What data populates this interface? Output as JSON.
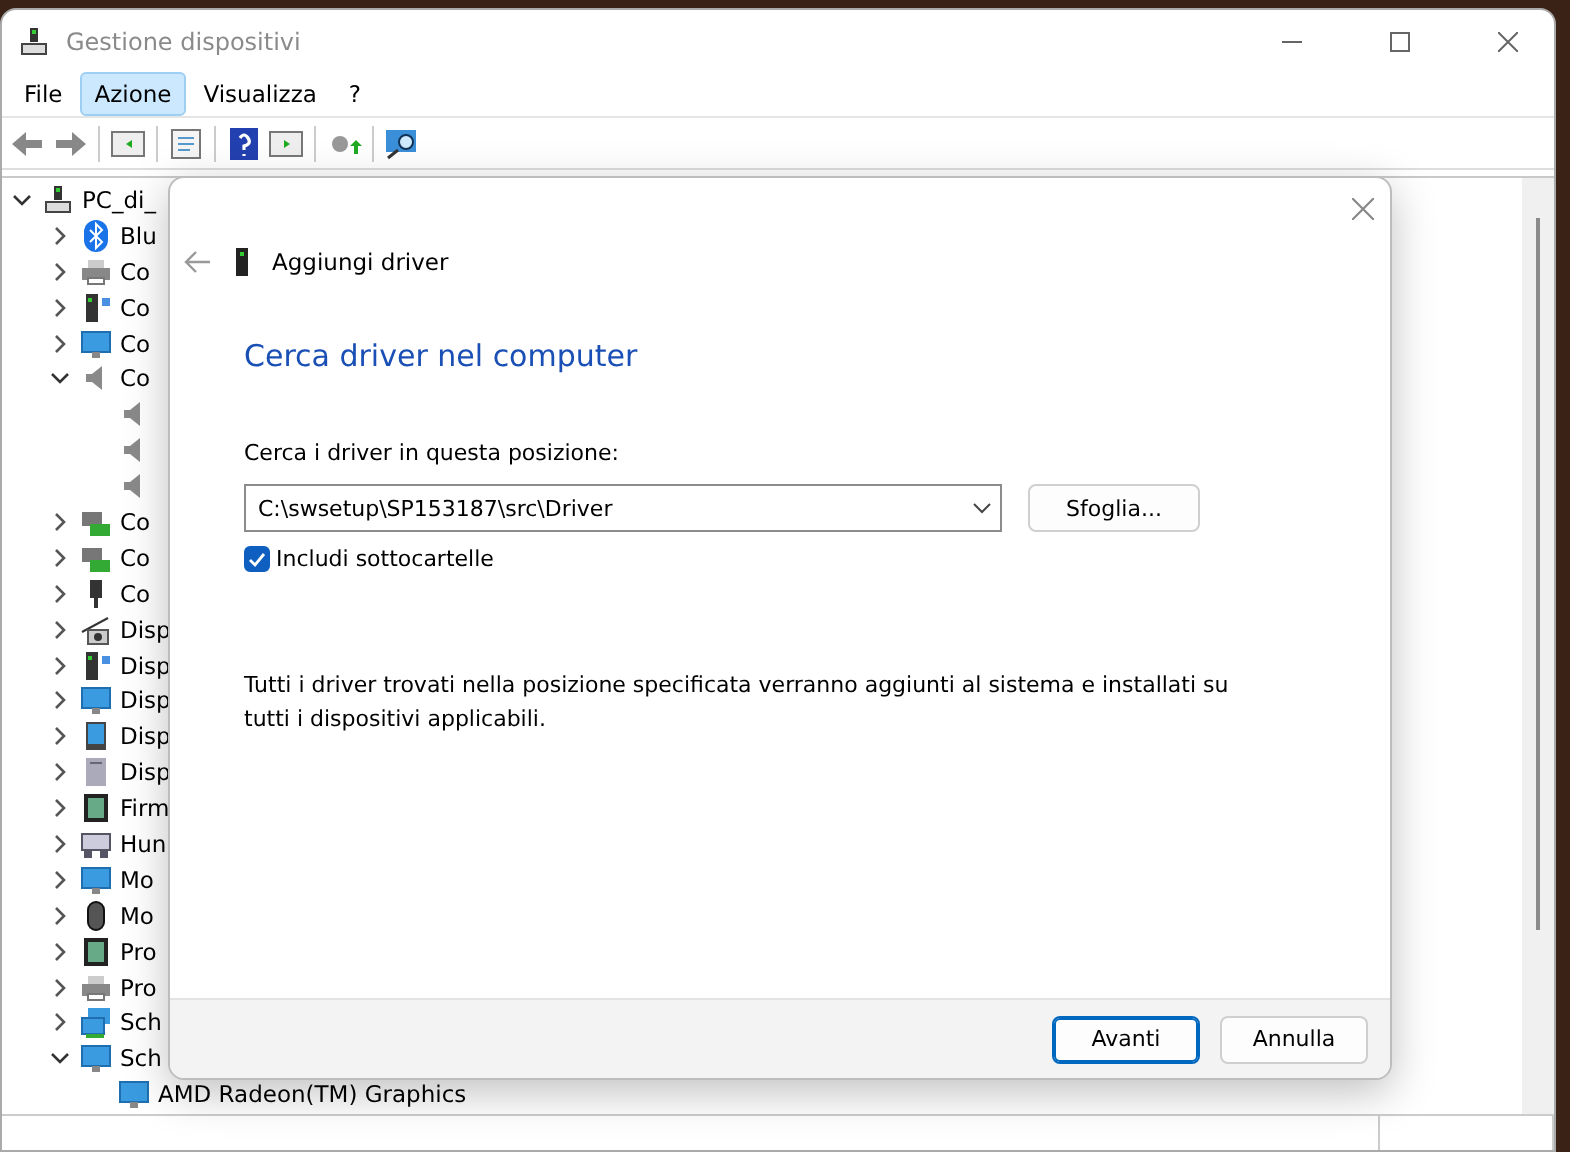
{
  "window": {
    "title": "Gestione dispositivi"
  },
  "menu": [
    {
      "label": "File",
      "selected": false
    },
    {
      "label": "Azione",
      "selected": true
    },
    {
      "label": "Visualizza",
      "selected": false
    },
    {
      "label": "?",
      "selected": false
    }
  ],
  "toolbar": [
    {
      "kind": "back"
    },
    {
      "kind": "forward"
    },
    {
      "kind": "separator"
    },
    {
      "kind": "panel"
    },
    {
      "kind": "separator"
    },
    {
      "kind": "properties"
    },
    {
      "kind": "separator"
    },
    {
      "kind": "help"
    },
    {
      "kind": "run"
    },
    {
      "kind": "separator"
    },
    {
      "kind": "update"
    },
    {
      "kind": "separator"
    },
    {
      "kind": "scan"
    }
  ],
  "tree": [
    {
      "label": "PC_di_",
      "kind": "computer",
      "expanded": true,
      "children": [
        {
          "label": "Blu",
          "kind": "bluetooth",
          "expanded": false
        },
        {
          "label": "Co",
          "kind": "printer",
          "expanded": false
        },
        {
          "label": "Co",
          "kind": "tower",
          "expanded": false
        },
        {
          "label": "Co",
          "kind": "monitor",
          "expanded": false
        },
        {
          "label": "Co",
          "kind": "speaker",
          "expanded": true,
          "children": [
            {
              "kind": "speaker"
            },
            {
              "kind": "speaker"
            },
            {
              "kind": "speaker"
            }
          ]
        },
        {
          "label": "Co",
          "kind": "card",
          "expanded": false
        },
        {
          "label": "Co",
          "kind": "card",
          "expanded": false
        },
        {
          "label": "Co",
          "kind": "usb",
          "expanded": false
        },
        {
          "label": "Disp",
          "kind": "camera",
          "expanded": false
        },
        {
          "label": "Disp",
          "kind": "tower",
          "expanded": false
        },
        {
          "label": "Disp",
          "kind": "monitor",
          "expanded": false
        },
        {
          "label": "Disp",
          "kind": "tablet",
          "expanded": false
        },
        {
          "label": "Disp",
          "kind": "disk",
          "expanded": false
        },
        {
          "label": "Firm",
          "kind": "chip",
          "expanded": false
        },
        {
          "label": "Hun",
          "kind": "keyboard",
          "expanded": false
        },
        {
          "label": "Mo",
          "kind": "monitor",
          "expanded": false
        },
        {
          "label": "Mo",
          "kind": "mouse",
          "expanded": false
        },
        {
          "label": "Pro",
          "kind": "chip",
          "expanded": false
        },
        {
          "label": "Pro",
          "kind": "printer",
          "expanded": false
        },
        {
          "label": "Sch",
          "kind": "network",
          "expanded": false
        },
        {
          "label": "Sch",
          "kind": "monitor",
          "expanded": true,
          "children": [
            {
              "label": "AMD Radeon(TM) Graphics",
              "kind": "display"
            }
          ]
        }
      ]
    }
  ],
  "dialog": {
    "title": "Aggiungi driver",
    "heading": "Cerca driver nel computer",
    "field_label": "Cerca i driver in questa posizione:",
    "path": "C:\\swsetup\\SP153187\\src\\Driver",
    "browse": "Sfoglia...",
    "include_subfolders": {
      "label": "Includi sottocartelle",
      "checked": true
    },
    "description": "Tutti i driver trovati nella posizione specificata verranno aggiunti al sistema e installati su tutti i dispositivi applicabili.",
    "buttons": [
      {
        "label": "Avanti",
        "default": true
      },
      {
        "label": "Annulla",
        "default": false
      }
    ]
  }
}
